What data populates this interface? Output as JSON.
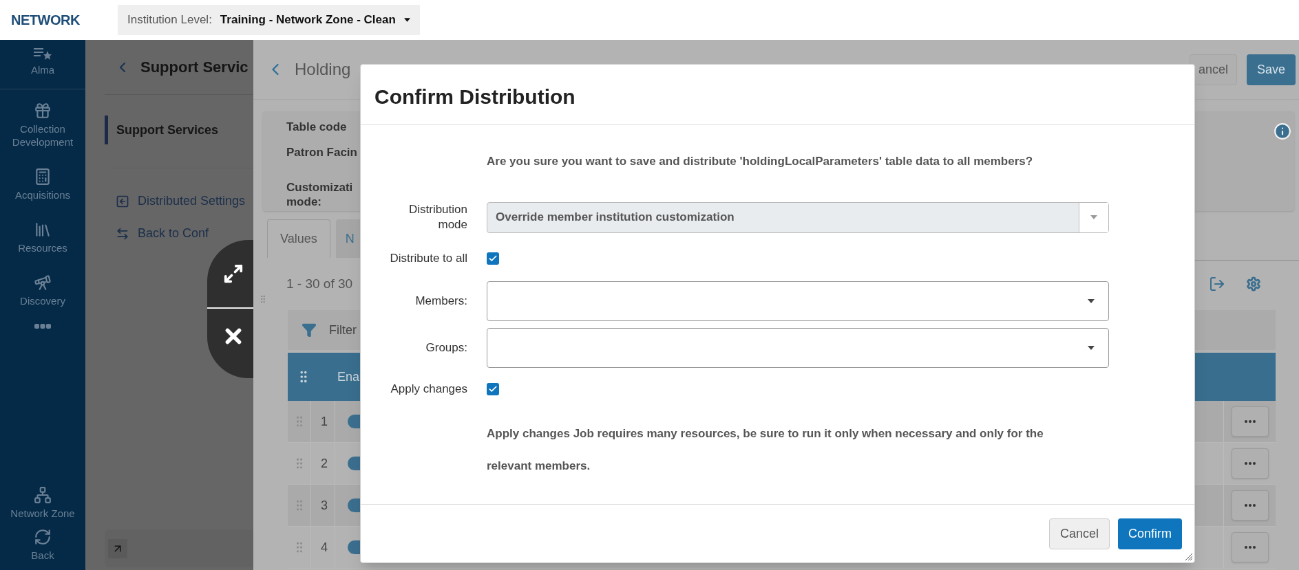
{
  "header": {
    "logo": "NETWORK",
    "institution_label": "Institution Level:",
    "institution_value": "Training - Network Zone - Clean"
  },
  "sidebar": {
    "items": [
      {
        "label": "Alma"
      },
      {
        "label": "Collection Development"
      },
      {
        "label": "Acquisitions"
      },
      {
        "label": "Resources"
      },
      {
        "label": "Discovery"
      },
      {
        "label": "Network Zone"
      },
      {
        "label": "Back"
      }
    ]
  },
  "left_panel": {
    "title": "Support Servic",
    "menu_items": [
      {
        "label": "Support Services",
        "selected": true
      }
    ],
    "links": [
      "Distributed Settings",
      "Back to Conf"
    ]
  },
  "detail": {
    "title": "Holding",
    "buttons": [
      "ancel",
      "Save"
    ],
    "card": {
      "label": "Table code",
      "value": "Patron Facin",
      "label_2_lines": [
        "Customizati",
        "mode:"
      ]
    },
    "tabs": [
      {
        "label": "Values",
        "selected": true
      },
      {
        "label": "N",
        "selected": false
      }
    ],
    "count": "1 - 30 of 30",
    "filter": "Filter",
    "column": "Ena",
    "rows": [
      {
        "number": "1",
        "enabled": true
      },
      {
        "number": "2",
        "enabled": true
      },
      {
        "number": "3",
        "enabled": true
      },
      {
        "number": "4",
        "enabled": true
      }
    ]
  },
  "dialog": {
    "title": "Confirm Distribution",
    "question": "Are you sure you want to save and distribute 'holdingLocalParameters' table data to all members?",
    "fields": [
      {
        "kind": "select",
        "label": "Distribution mode",
        "value": "Override member institution customization"
      },
      {
        "kind": "checkbox",
        "label": "Distribute to all",
        "checked": true
      },
      {
        "kind": "dropdown",
        "label": "Members:"
      },
      {
        "kind": "dropdown",
        "label": "Groups:"
      },
      {
        "kind": "checkbox",
        "label": "Apply changes",
        "checked": true
      }
    ],
    "warning": "Apply changes Job requires many resources, be sure to run it only when necessary and only for the relevant members.",
    "buttons": [
      {
        "label": "Cancel",
        "kind": "secondary"
      },
      {
        "label": "Confirm",
        "kind": "primary"
      }
    ]
  }
}
